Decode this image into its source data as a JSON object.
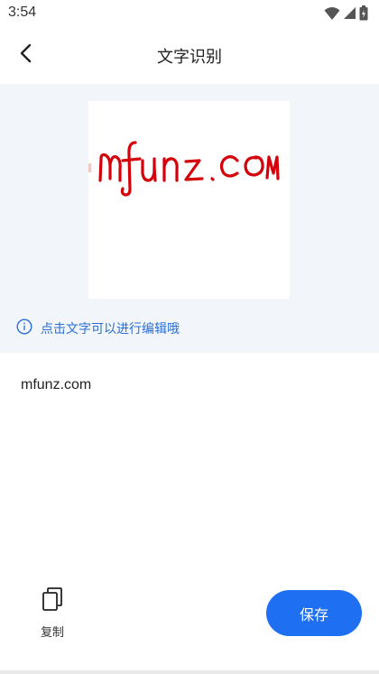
{
  "status_bar": {
    "time": "3:54",
    "icons": [
      "wifi-icon",
      "signal-icon",
      "battery-icon"
    ]
  },
  "nav": {
    "title": "文字识别",
    "back_icon": "chevron-left-icon"
  },
  "image_panel": {
    "handwritten_text": "mfunz.COM",
    "hint_icon": "info-circle-icon",
    "hint": "点击文字可以进行编辑哦"
  },
  "result": {
    "text": "mfunz.com"
  },
  "actions": {
    "copy_label": "复制",
    "copy_icon": "copy-icon",
    "save_label": "保存"
  },
  "colors": {
    "accent": "#1f6ff2",
    "hint": "#2a6fd6",
    "panel_bg": "#f2f5f9",
    "ink": "#d4000a"
  }
}
